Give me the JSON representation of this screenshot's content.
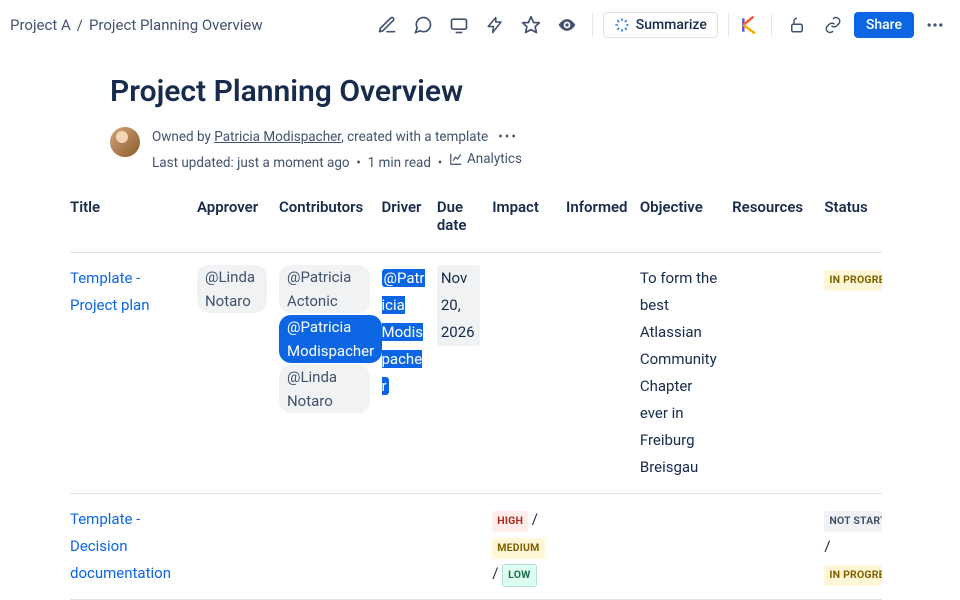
{
  "breadcrumbs": {
    "space": "Project A",
    "sep": "/",
    "page": "Project Planning Overview"
  },
  "toolbar": {
    "summarize": "Summarize",
    "share": "Share"
  },
  "title": "Project Planning Overview",
  "meta": {
    "owned_by_prefix": "Owned by ",
    "owner": "Patricia Modispacher",
    "created_suffix": ", created with a template",
    "last_updated": "Last updated: just a moment ago",
    "read_time": "1 min read",
    "analytics": "Analytics"
  },
  "columns": {
    "title": "Title",
    "approver": "Approver",
    "contributors": "Contributors",
    "driver": "Driver",
    "due": "Due date",
    "impact": "Impact",
    "informed": "Informed",
    "objective": "Objective",
    "resources": "Resources",
    "status": "Status"
  },
  "rows": [
    {
      "title": "Template - Project plan",
      "approver": "@Linda Notaro",
      "contributors": [
        "@Patricia Actonic",
        "@Patricia Modispacher",
        "@Linda Notaro"
      ],
      "contributors_selected": 1,
      "driver": "@Patricia Modispacher",
      "due": "Nov 20, 2026",
      "impact": [],
      "informed": "",
      "objective": "To form the best Atlassian Community Chapter ever in Freiburg Breisgau",
      "resources": "",
      "status": [
        "IN PROGRESS"
      ]
    },
    {
      "title": "Template - Decision documentation",
      "approver": "",
      "contributors": [],
      "driver": "",
      "due": "",
      "impact": [
        "HIGH",
        "MEDIUM",
        "LOW"
      ],
      "informed": "",
      "objective": "",
      "resources": "",
      "status": [
        "NOT STARTED",
        "IN PROGRESS"
      ]
    }
  ]
}
